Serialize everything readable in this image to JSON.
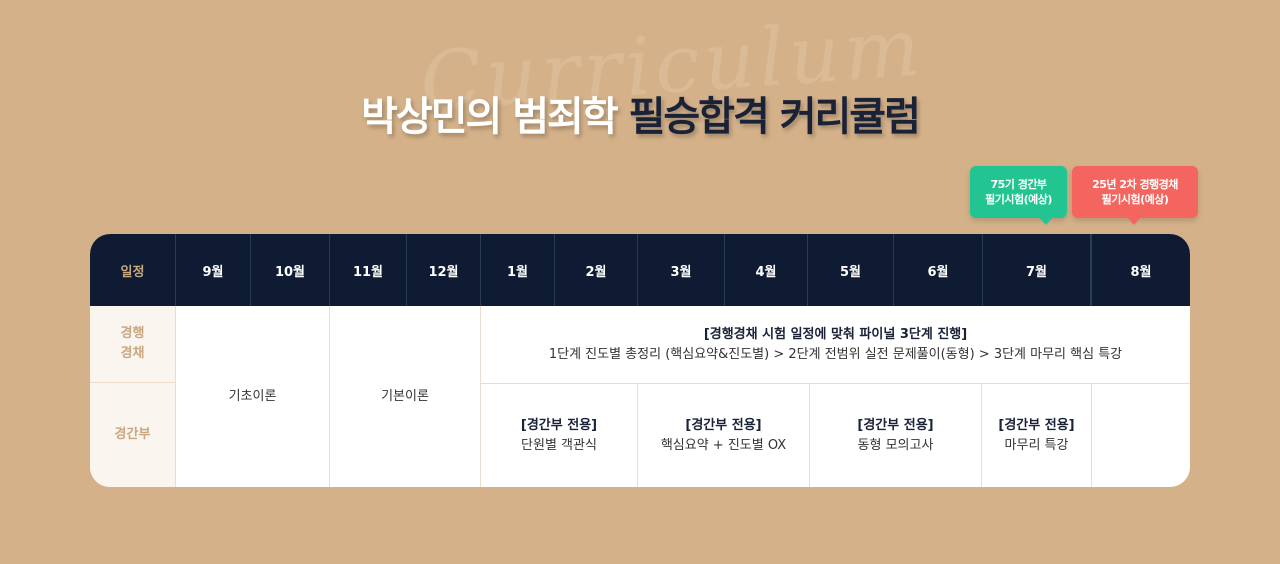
{
  "watermark": "Curriculum",
  "title": {
    "part1": "박상민의 범죄학",
    "part2": "필승합격 커리큘럼"
  },
  "bubbles": [
    {
      "line1": "75기 경간부",
      "line2": "필기시험(예상)",
      "color": "#22c591"
    },
    {
      "line1": "25년 2차 경행경채",
      "line2": "필기시험(예상)",
      "color": "#f4655f"
    }
  ],
  "table": {
    "corner": "일정",
    "months": [
      "9월",
      "10월",
      "11월",
      "12월",
      "1월",
      "2월",
      "3월",
      "4월",
      "5월",
      "6월",
      "7월",
      "8월"
    ],
    "rows": [
      {
        "label_line1": "경행",
        "label_line2": "경채"
      },
      {
        "label": "경간부"
      }
    ],
    "basic": "기초이론",
    "foundation": "기본이론",
    "main": {
      "heading": "[경행경채 시험 일정에 맞춰 파이널 3단계 진행]",
      "detail": "1단계 진도별 총정리 (핵심요약&진도별) > 2단계 전범위 실전 문제풀이(동형) > 3단계 마무리 핵심 특강"
    },
    "sub": [
      {
        "heading": "[경간부 전용]",
        "text": "단원별 객관식"
      },
      {
        "heading": "[경간부 전용]",
        "text": "핵심요약 + 진도별 OX"
      },
      {
        "heading": "[경간부 전용]",
        "text": "동형 모의고사"
      },
      {
        "heading": "[경간부 전용]",
        "text": "마무리 특강"
      }
    ]
  },
  "colors": {
    "background": "#d4b189",
    "header": "#0f1b33",
    "accent": "#c9a77f"
  }
}
